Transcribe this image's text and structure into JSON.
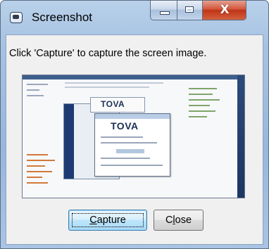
{
  "window": {
    "title": "Screenshot",
    "icon": "screenshot-app-icon",
    "caption_buttons": {
      "minimize_icon": "minimize-icon",
      "maximize_icon": "maximize-icon",
      "close_icon": "close-icon",
      "close_glyph": "X"
    }
  },
  "dialog": {
    "instruction": "Click 'Capture' to capture the screen image.",
    "preview": {
      "content": "captured-screen-thumbnail",
      "logo_text_back": "TOVA",
      "logo_text_front": "TOVA"
    },
    "buttons": {
      "capture": {
        "label": "Capture",
        "mnemonic": "C",
        "rest": "apture",
        "is_default": true
      },
      "close": {
        "label": "Close",
        "prefix": "C",
        "mnemonic": "l",
        "rest": "ose"
      }
    }
  },
  "colors": {
    "title_bar": "#a6c2e2",
    "close_button": "#c7401f",
    "default_button_border": "#3c7fb1",
    "dialog_background": "#f0f0f0"
  }
}
